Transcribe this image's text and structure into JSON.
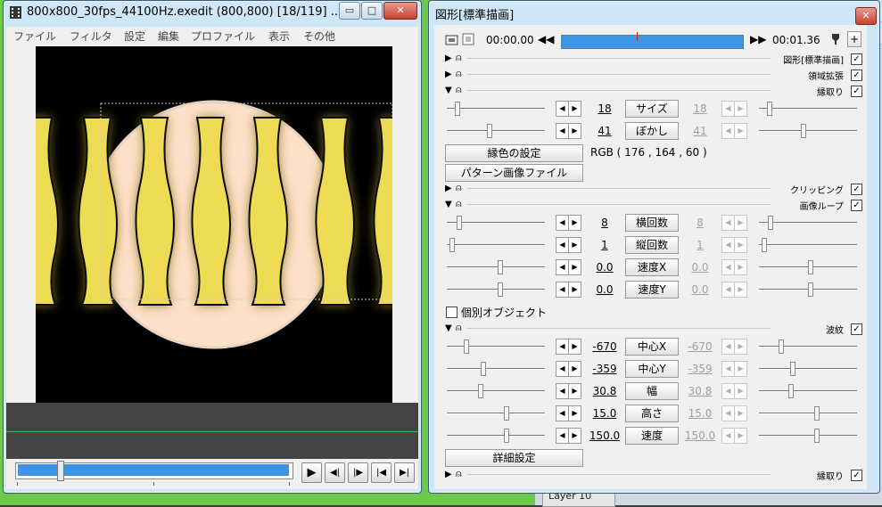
{
  "left_window": {
    "title": "800x800_30fps_44100Hz.exedit (800,800)  [18/119]  ...",
    "min_label": "▭",
    "max_label": "□",
    "close_label": "✕",
    "menu": [
      "ファイル",
      "フィルタ",
      "設定",
      "編集",
      "プロファイル",
      "表示",
      "その他"
    ],
    "transport": {
      "play": "▶",
      "prev_frame": "◀|",
      "next_frame": "|▶",
      "to_start": "|◀",
      "to_end": "▶|"
    }
  },
  "right_window": {
    "title": "図形[標準描画]",
    "close_label": "✕",
    "time_start": "00:00.00",
    "time_end": "00:01.36",
    "sections": {
      "standard": "図形[標準描画]",
      "region": "領域拡張",
      "border": "縁取り",
      "clipping": "クリッピング",
      "loop": "画像ループ",
      "wave": "波紋",
      "border2": "縁取り"
    },
    "border_params": [
      {
        "label": "サイズ",
        "value": "18",
        "end": "18"
      },
      {
        "label": "ぼかし",
        "value": "41",
        "end": "41"
      }
    ],
    "color_button": "縁色の設定",
    "rgb_text": "RGB ( 176 , 164 , 60 )",
    "pattern_button": "パターン画像ファイル",
    "loop_params": [
      {
        "label": "横回数",
        "value": "8",
        "end": "8"
      },
      {
        "label": "縦回数",
        "value": "1",
        "end": "1"
      },
      {
        "label": "速度X",
        "value": "0.0",
        "end": "0.0"
      },
      {
        "label": "速度Y",
        "value": "0.0",
        "end": "0.0"
      }
    ],
    "individual_object": "個別オブジェクト",
    "wave_params": [
      {
        "label": "中心X",
        "value": "-670",
        "end": "-670"
      },
      {
        "label": "中心Y",
        "value": "-359",
        "end": "-359"
      },
      {
        "label": "幅",
        "value": "30.8",
        "end": "30.8"
      },
      {
        "label": "高さ",
        "value": "15.0",
        "end": "15.0"
      },
      {
        "label": "速度",
        "value": "150.0",
        "end": "150.0"
      }
    ],
    "detail_button": "詳細設定",
    "check_mark": "✓",
    "arrow_left": "◀",
    "arrow_right": "▶",
    "expand_down": "▼",
    "expand_right": "▶",
    "rewind": "◀◀",
    "forward": "▶▶",
    "plus": "+",
    "mouse_icon": "⍝"
  },
  "background_window": {
    "layer_label": "Layer 10"
  },
  "colors": {
    "accent_blue": "#3d93e6",
    "border_yellow": "#eddc53",
    "circle_fill": "#fde0c8"
  }
}
